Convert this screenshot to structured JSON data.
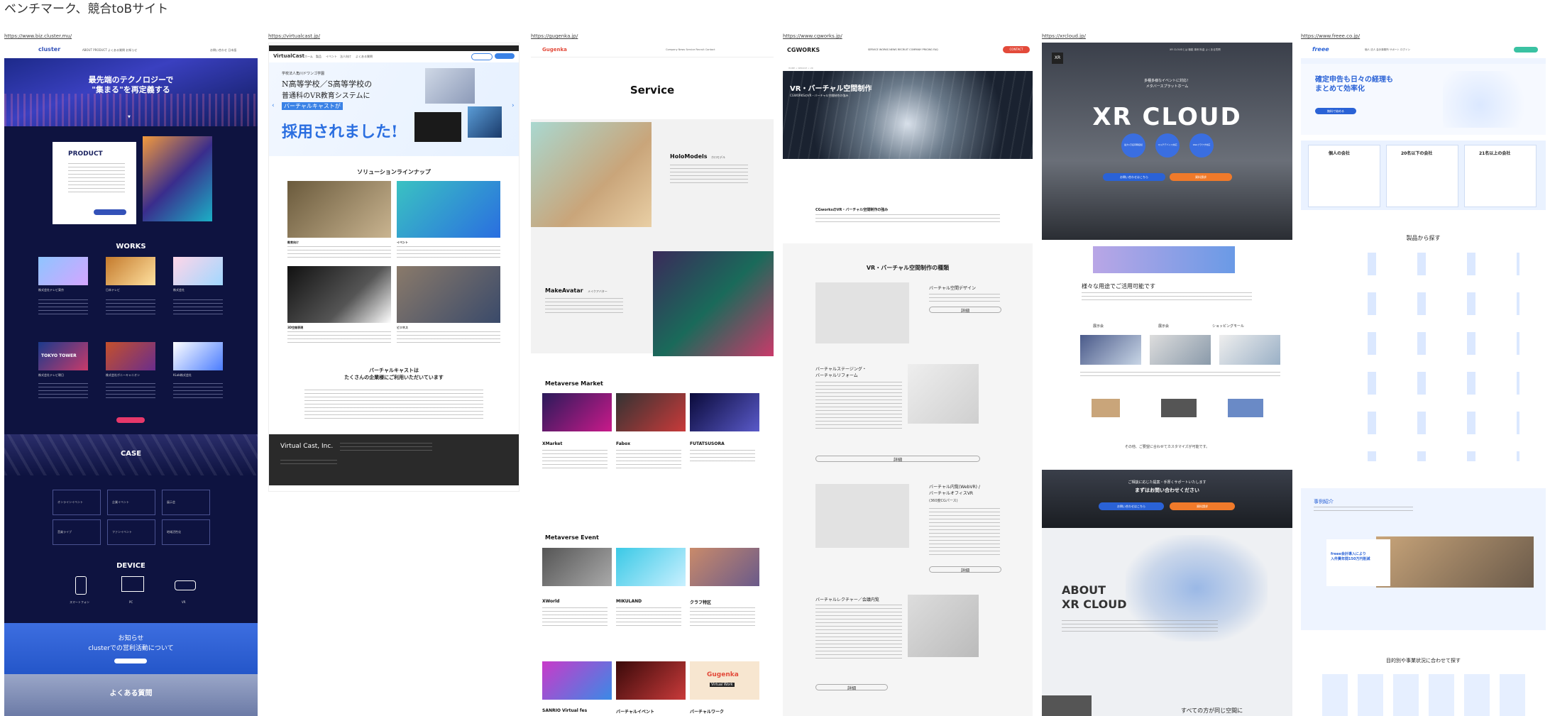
{
  "board": {
    "title": "ベンチマーク、競合toBサイト"
  },
  "columns": [
    {
      "url": "https://www.biz.cluster.mu/",
      "logo": "cluster",
      "hero_title": "最先端のテクノロジーで\n\"集まる\"を再定義する",
      "product_heading": "PRODUCT",
      "works_heading": "WORKS",
      "works_items": [
        "株式会社テレビ東京",
        "日本テレビ",
        "株式会社",
        "株式会社テレビ朝日",
        "株式会社ポニーキャニオン",
        "KLab株式会社"
      ],
      "tokyo_tower": "TOKYO TOWER",
      "case_heading": "CASE",
      "case_tiles": [
        "オンラインイベント",
        "企業イベント",
        "展示会",
        "音楽ライブ",
        "ファンイベント",
        "地域活性化"
      ],
      "device_heading": "DEVICE",
      "devices": [
        "スマートフォン",
        "PC",
        "VR"
      ],
      "notice_title": "お知らせ",
      "notice_sub": "clusterでの営利活動について",
      "faq_heading": "よくある質問"
    },
    {
      "url": "https://virtualcast.jp/",
      "logo": "VirtualCast",
      "nav_items": [
        "ホーム",
        "製品",
        "イベント",
        "法人向け",
        "よくある質問"
      ],
      "hero_small": "学校法人角川ドワンゴ学園",
      "hero_line1": "N高等学校／S高等学校の",
      "hero_line2": "普通科のVR教育システムに",
      "hero_line3": "バーチャルキャストが",
      "hero_big": "採用されました!",
      "solutions_heading": "ソリューションラインナップ",
      "solution_labels": [
        "教育向け",
        "イベント",
        "3D空間表現",
        "ビジネス"
      ],
      "clients_heading": "バーチャルキャストは\nたくさんの企業様にご利用いただいています",
      "footer_logo": "Virtual Cast, Inc."
    },
    {
      "url": "https://gugenka.jp/",
      "logo": "Gugenka",
      "service_heading": "Service",
      "holo_title": "HoloModels",
      "holo_sub": "ホロモデル",
      "make_title": "MakeAvatar",
      "make_sub": "メイクアバター",
      "market_heading": "Metaverse Market",
      "market_items": [
        "XMarket",
        "Fabox",
        "FUTATSUSORA"
      ],
      "event_heading": "Metaverse Event",
      "event_items": [
        "XWorld",
        "MIKULAND",
        "クラフ特区"
      ],
      "bottom_items": [
        "SANRIO Virtual fes",
        "バーチャルイベント",
        "バーチャルワーク"
      ],
      "gugenka_badge": "Gugenka",
      "gugenka_badge_sub": "Virtual Work"
    },
    {
      "url": "https://www.cgworks.jp/",
      "logo": "CGWORKS",
      "contact_btn": "CONTACT",
      "hero_title": "VR・バーチャル空間制作",
      "hero_sub": "CGWORKSのVR・バーチャル空間制作の強み",
      "intro_title": "CGworksのVR・バーチャル空間制作の強み",
      "types_heading": "VR・バーチャル空間制作の種類",
      "item1": "バーチャル空間デザイン",
      "item2": "バーチャルステージング・\nバーチャルリフォーム",
      "item3": "バーチャル内覧(WebVR) /\nバーチャルオフィスVR",
      "item3_sub": "(360度CGパース)",
      "item4": "バーチャルレクチャー／会議内覧",
      "detail_label": "詳細"
    },
    {
      "url": "https://xrcloud.jp/",
      "xr_badge": "XR",
      "hero_tagline": "多種多様なイベントに対応！",
      "hero_tagline2": "メタバースプラットホーム",
      "hero_logo": "XR CLOUD",
      "circles": [
        "最大1万名同時接続",
        "マルチデバイス対応",
        "Webブラウザ対応"
      ],
      "btn_primary": "お問い合わせはこちら",
      "btn_secondary": "資料請求",
      "usage_heading": "様々な用途でご活用可能です",
      "usage_items": [
        "展示会",
        "展示会",
        "ショッピングモール"
      ],
      "customize_note": "その他、ご要望に合わせてカスタマイズが可能です。",
      "cta_text": "ご相談に応じた提案・手厚くサポートいたします",
      "cta_sub": "まずはお問い合わせください",
      "about_heading": "ABOUT\nXR CLOUD",
      "bottom_text": "すべての方が同じ空間に"
    },
    {
      "url": "https://www.freee.co.jp/",
      "logo": "freee",
      "hero_headline": "確定申告も日々の経理も\nまとめて効率化",
      "hero_btn": "無料で始める",
      "plans": [
        "個人の会社",
        "20名以下の会社",
        "21名以上の会社"
      ],
      "products_heading": "製品から探す",
      "case_heading": "事例紹介",
      "case_title": "freee会計導入により\n入件費年間150万円削減",
      "search_heading": "目的別や事業状況に合わせて探す"
    }
  ]
}
